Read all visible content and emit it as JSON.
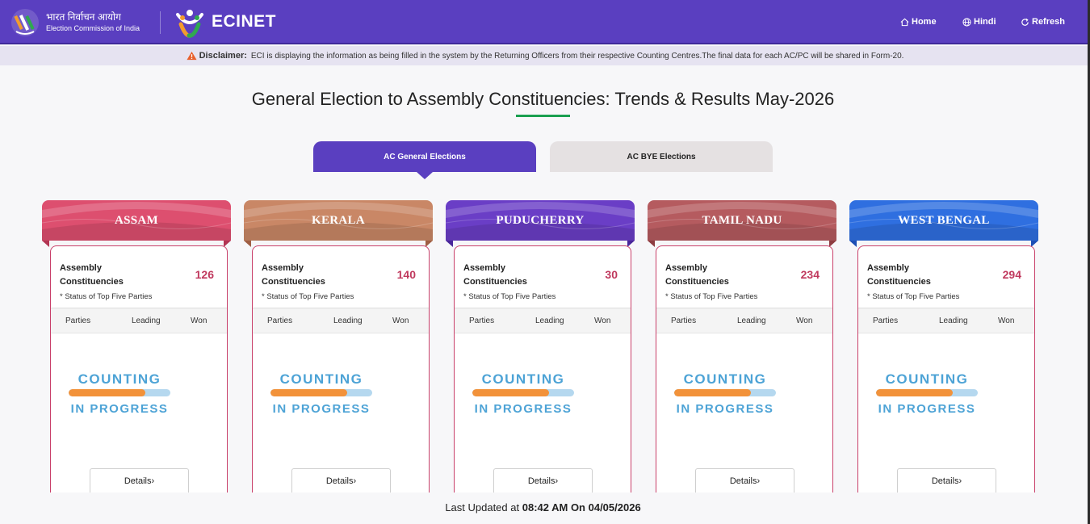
{
  "header": {
    "eci_hindi": "भारत निर्वाचन आयोग",
    "eci_english": "Election Commission of India",
    "ecinet_label": "ECINET",
    "nav": [
      {
        "label": "Home",
        "icon": "home-icon"
      },
      {
        "label": "Hindi",
        "icon": "globe-icon"
      },
      {
        "label": "Refresh",
        "icon": "refresh-icon"
      }
    ],
    "bg_color": "#5a3fc0"
  },
  "disclaimer": {
    "label": "Disclaimer:",
    "text": "ECI is displaying the information as being filled in the system by the Returning Officers from their respective Counting Centres.The final data for each AC/PC will be shared in Form-20."
  },
  "page_title": "General Election to Assembly Constituencies: Trends & Results May-2026",
  "tabs": [
    {
      "label": "AC General Elections",
      "active": true
    },
    {
      "label": "AC BYE Elections",
      "active": false
    }
  ],
  "card_common": {
    "ac_label_line1": "Assembly",
    "ac_label_line2": "Constituencies",
    "status_note": "* Status of Top Five Parties",
    "col_parties": "Parties",
    "col_leading": "Leading",
    "col_won": "Won",
    "counting_line1": "COUNTING",
    "counting_line2": "IN PROGRESS",
    "progress_fraction": 0.75,
    "details_label": "Details›"
  },
  "states": [
    {
      "name": "ASSAM",
      "count": "126",
      "color": "#dd4f6f",
      "dark": "#b23553",
      "count_color": "#c0395e",
      "border": "#c9406a"
    },
    {
      "name": "KERALA",
      "count": "140",
      "color": "#c98766",
      "dark": "#9f5e43",
      "count_color": "#c0395e",
      "border": "#c9406a"
    },
    {
      "name": "PUDUCHERRY",
      "count": "30",
      "color": "#6a3ec6",
      "dark": "#48269a",
      "count_color": "#c0395e",
      "border": "#c9406a"
    },
    {
      "name": "TAMIL NADU",
      "count": "234",
      "color": "#b55b5f",
      "dark": "#8e3c41",
      "count_color": "#c0395e",
      "border": "#c9406a"
    },
    {
      "name": "WEST BENGAL",
      "count": "294",
      "color": "#2f6fe0",
      "dark": "#1c4fb5",
      "count_color": "#c0395e",
      "border": "#c9406a"
    }
  ],
  "footer": {
    "prefix": "Last Updated at",
    "time": "08:42 AM On 04/05/2026"
  }
}
